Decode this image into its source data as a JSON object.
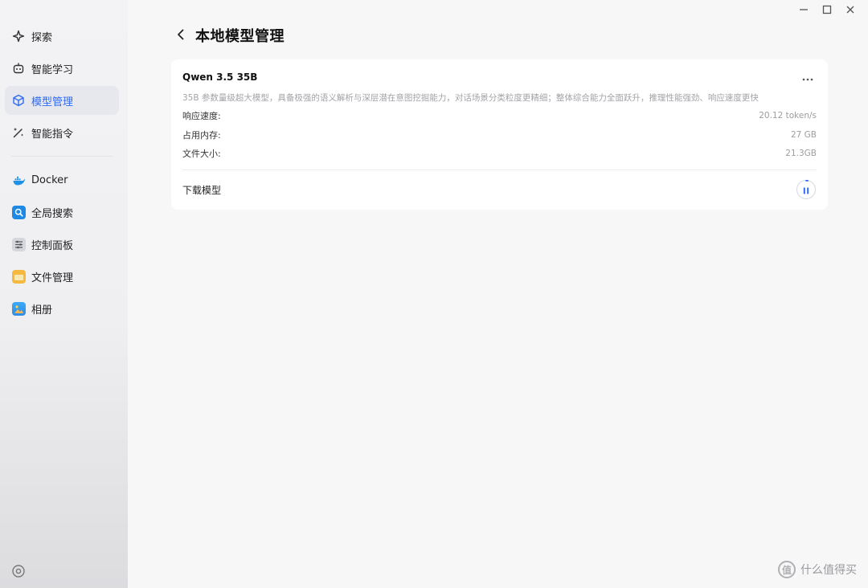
{
  "sidebar": {
    "items": [
      {
        "label": "探索",
        "icon": "sparkle-icon"
      },
      {
        "label": "智能学习",
        "icon": "robot-icon"
      },
      {
        "label": "模型管理",
        "icon": "cube-icon",
        "active": true
      },
      {
        "label": "智能指令",
        "icon": "magic-wand-icon"
      }
    ],
    "apps": [
      {
        "label": "Docker",
        "icon": "docker-icon"
      },
      {
        "label": "全局搜索",
        "icon": "search-app-icon"
      },
      {
        "label": "控制面板",
        "icon": "control-panel-icon"
      },
      {
        "label": "文件管理",
        "icon": "folder-icon"
      },
      {
        "label": "相册",
        "icon": "photo-album-icon"
      }
    ],
    "settings_icon": "settings-icon"
  },
  "window_controls": {
    "minimize": "minimize-icon",
    "maximize": "maximize-icon",
    "close": "close-icon"
  },
  "header": {
    "title": "本地模型管理",
    "back_icon": "chevron-left-icon"
  },
  "model_card": {
    "name": "Qwen 3.5 35B",
    "description": "35B 参数量级超大模型，具备极强的语义解析与深层潜在意图挖掘能力，对话场景分类粒度更精细；整体综合能力全面跃升，推理性能强劲、响应速度更快",
    "stats": [
      {
        "label": "响应速度:",
        "value": "20.12 token/s"
      },
      {
        "label": "占用内存:",
        "value": "27 GB"
      },
      {
        "label": "文件大小:",
        "value": "21.3GB"
      }
    ],
    "download_label": "下载模型",
    "download_progress": 0.03
  },
  "colors": {
    "accent": "#2f6bf0",
    "active_bg": "#e6e8ee"
  },
  "watermark": {
    "logo": "值",
    "text": "什么值得买"
  }
}
